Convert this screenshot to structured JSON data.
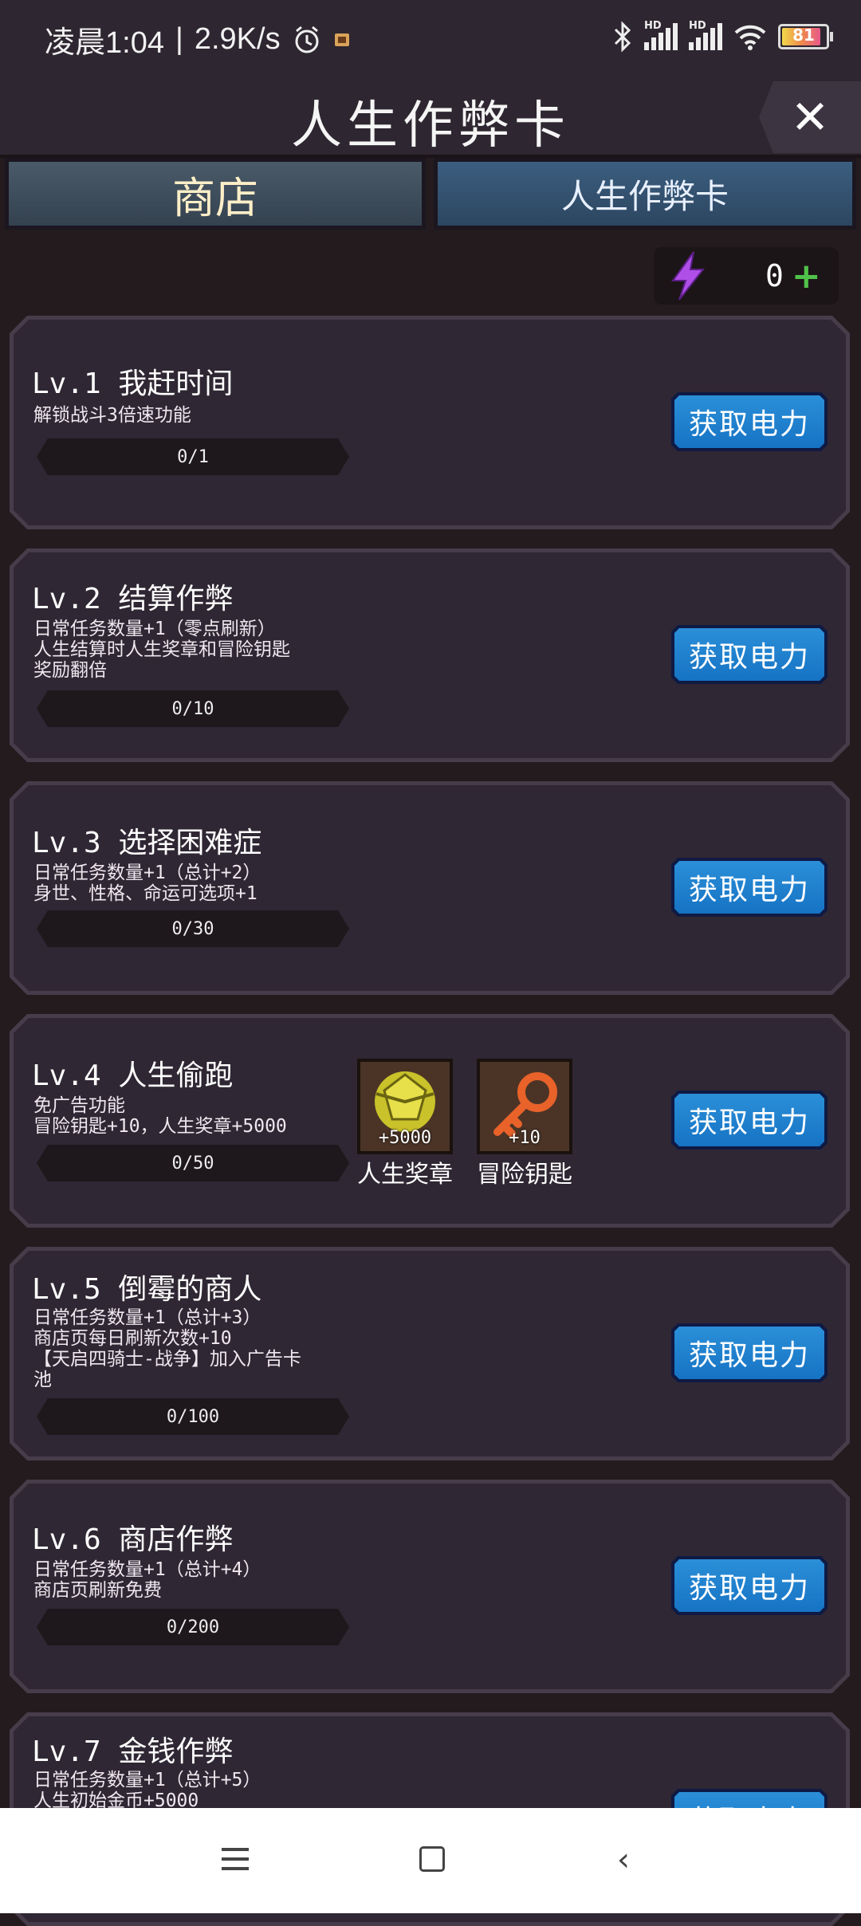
{
  "status_bar": {
    "time": "凌晨1:04",
    "speed": "2.9K/s",
    "signal1_label": "HD",
    "signal2_label": "HD",
    "battery": "81"
  },
  "header": {
    "title": "人生作弊卡",
    "close_icon": "close-icon"
  },
  "tabs": [
    {
      "label": "商店"
    },
    {
      "label": "人生作弊卡"
    }
  ],
  "energy": {
    "value": "0",
    "plus": "+"
  },
  "cards": [
    {
      "title": "Lv.1 我赶时间",
      "desc": "解锁战斗3倍速功能",
      "progress": "0/1",
      "button": "获取电力"
    },
    {
      "title": "Lv.2 结算作弊",
      "desc": "日常任务数量+1（零点刷新）\n人生结算时人生奖章和冒险钥匙\n奖励翻倍",
      "progress": "0/10",
      "button": "获取电力"
    },
    {
      "title": "Lv.3 选择困难症",
      "desc": "日常任务数量+1（总计+2）\n身世、性格、命运可选项+1",
      "progress": "0/30",
      "button": "获取电力"
    },
    {
      "title": "Lv.4 人生偷跑",
      "desc": "免广告功能\n冒险钥匙+10，人生奖章+5000",
      "progress": "0/50",
      "button": "获取电力",
      "rewards": [
        {
          "amount": "+5000",
          "name": "人生奖章",
          "icon": "medal-icon"
        },
        {
          "amount": "+10",
          "name": "冒险钥匙",
          "icon": "key-icon"
        }
      ]
    },
    {
      "title": "Lv.5 倒霉的商人",
      "desc": "日常任务数量+1（总计+3）\n商店页每日刷新次数+10\n【天启四骑士-战争】加入广告卡\n池",
      "progress": "0/100",
      "button": "获取电力"
    },
    {
      "title": "Lv.6 商店作弊",
      "desc": "日常任务数量+1（总计+4）\n商店页刷新免费",
      "progress": "0/200",
      "button": "获取电力"
    },
    {
      "title": "Lv.7 金钱作弊",
      "desc": "日常任务数量+1（总计+5）\n人生初始金币+5000",
      "button": "获取电力"
    }
  ],
  "nav": {
    "menu_icon": "menu-icon",
    "home_icon": "home-icon",
    "back_icon": "back-icon"
  }
}
